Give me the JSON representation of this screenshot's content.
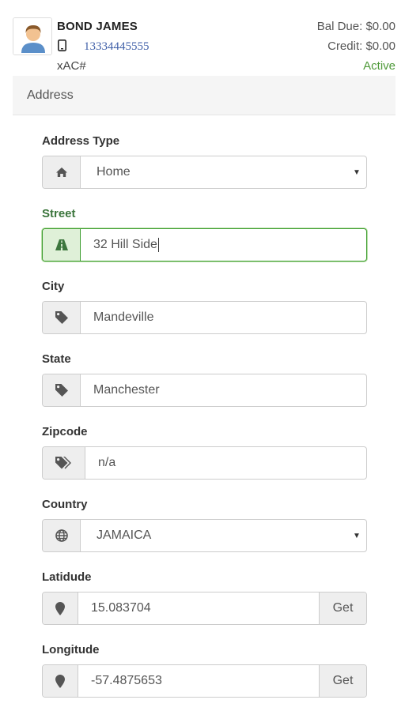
{
  "customer": {
    "name": "BOND JAMES",
    "phone": "13334445555",
    "account_label": "xAC#",
    "bal_due": "Bal Due: $0.00",
    "credit": "Credit: $0.00",
    "status": "Active"
  },
  "section": {
    "title": "Address"
  },
  "form": {
    "address_type": {
      "label": "Address Type",
      "value": "Home",
      "icon": "home-icon"
    },
    "street": {
      "label": "Street",
      "value": "32 Hill Side",
      "icon": "road-icon"
    },
    "city": {
      "label": "City",
      "value": "Mandeville",
      "icon": "tag-icon"
    },
    "state": {
      "label": "State",
      "value": "Manchester",
      "icon": "tag-icon"
    },
    "zipcode": {
      "label": "Zipcode",
      "value": "n/a",
      "icon": "tags-icon"
    },
    "country": {
      "label": "Country",
      "value": "JAMAICA",
      "icon": "globe-icon"
    },
    "latitude": {
      "label": "Latidude",
      "value": "15.083704",
      "button": "Get",
      "icon": "map-marker-icon"
    },
    "longitude": {
      "label": "Longitude",
      "value": "-57.4875653",
      "button": "Get",
      "icon": "map-marker-icon"
    }
  },
  "colors": {
    "success": "#3c763d",
    "status_active": "#4f9a3a",
    "link": "#3f5fa8"
  }
}
